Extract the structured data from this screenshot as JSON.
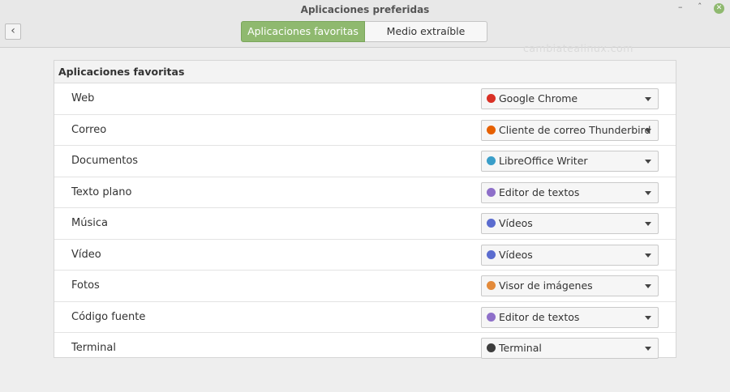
{
  "window": {
    "title": "Aplicaciones preferidas"
  },
  "tabs": [
    {
      "label": "Aplicaciones favoritas",
      "active": true
    },
    {
      "label": "Medio extraíble",
      "active": false
    }
  ],
  "watermark": "cambiatealinux.com",
  "panel": {
    "header": "Aplicaciones favoritas",
    "rows": [
      {
        "label": "Web",
        "app": "Google Chrome",
        "icon": "chrome-icon",
        "color": "#d93025"
      },
      {
        "label": "Correo",
        "app": "Cliente de correo Thunderbird",
        "icon": "thunderbird-icon",
        "color": "#e66000"
      },
      {
        "label": "Documentos",
        "app": "LibreOffice Writer",
        "icon": "writer-icon",
        "color": "#3a9ec9"
      },
      {
        "label": "Texto plano",
        "app": "Editor de textos",
        "icon": "text-editor-icon",
        "color": "#8e6fc9"
      },
      {
        "label": "Música",
        "app": "Vídeos",
        "icon": "videos-icon",
        "color": "#5b6ccf"
      },
      {
        "label": "Vídeo",
        "app": "Vídeos",
        "icon": "videos-icon",
        "color": "#5b6ccf"
      },
      {
        "label": "Fotos",
        "app": "Visor de imágenes",
        "icon": "image-viewer-icon",
        "color": "#e38a3a"
      },
      {
        "label": "Código fuente",
        "app": "Editor de textos",
        "icon": "text-editor-icon",
        "color": "#8e6fc9"
      },
      {
        "label": "Terminal",
        "app": "Terminal",
        "icon": "terminal-icon",
        "color": "#3c3c3c"
      }
    ]
  }
}
